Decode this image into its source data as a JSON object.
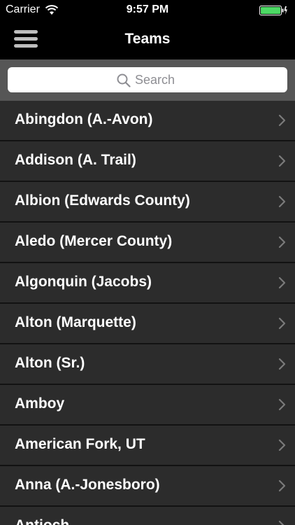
{
  "status_bar": {
    "carrier": "Carrier",
    "time": "9:57 PM",
    "battery_color": "#4cd964"
  },
  "nav": {
    "title": "Teams",
    "menu_icon": "hamburger-menu-icon"
  },
  "search": {
    "placeholder": "Search",
    "value": ""
  },
  "teams": [
    {
      "label": "Abingdon (A.-Avon)"
    },
    {
      "label": "Addison (A. Trail)"
    },
    {
      "label": "Albion (Edwards County)"
    },
    {
      "label": "Aledo (Mercer County)"
    },
    {
      "label": "Algonquin (Jacobs)"
    },
    {
      "label": "Alton (Marquette)"
    },
    {
      "label": "Alton (Sr.)"
    },
    {
      "label": "Amboy"
    },
    {
      "label": "American Fork, UT"
    },
    {
      "label": "Anna (A.-Jonesboro)"
    },
    {
      "label": "Antioch"
    }
  ]
}
